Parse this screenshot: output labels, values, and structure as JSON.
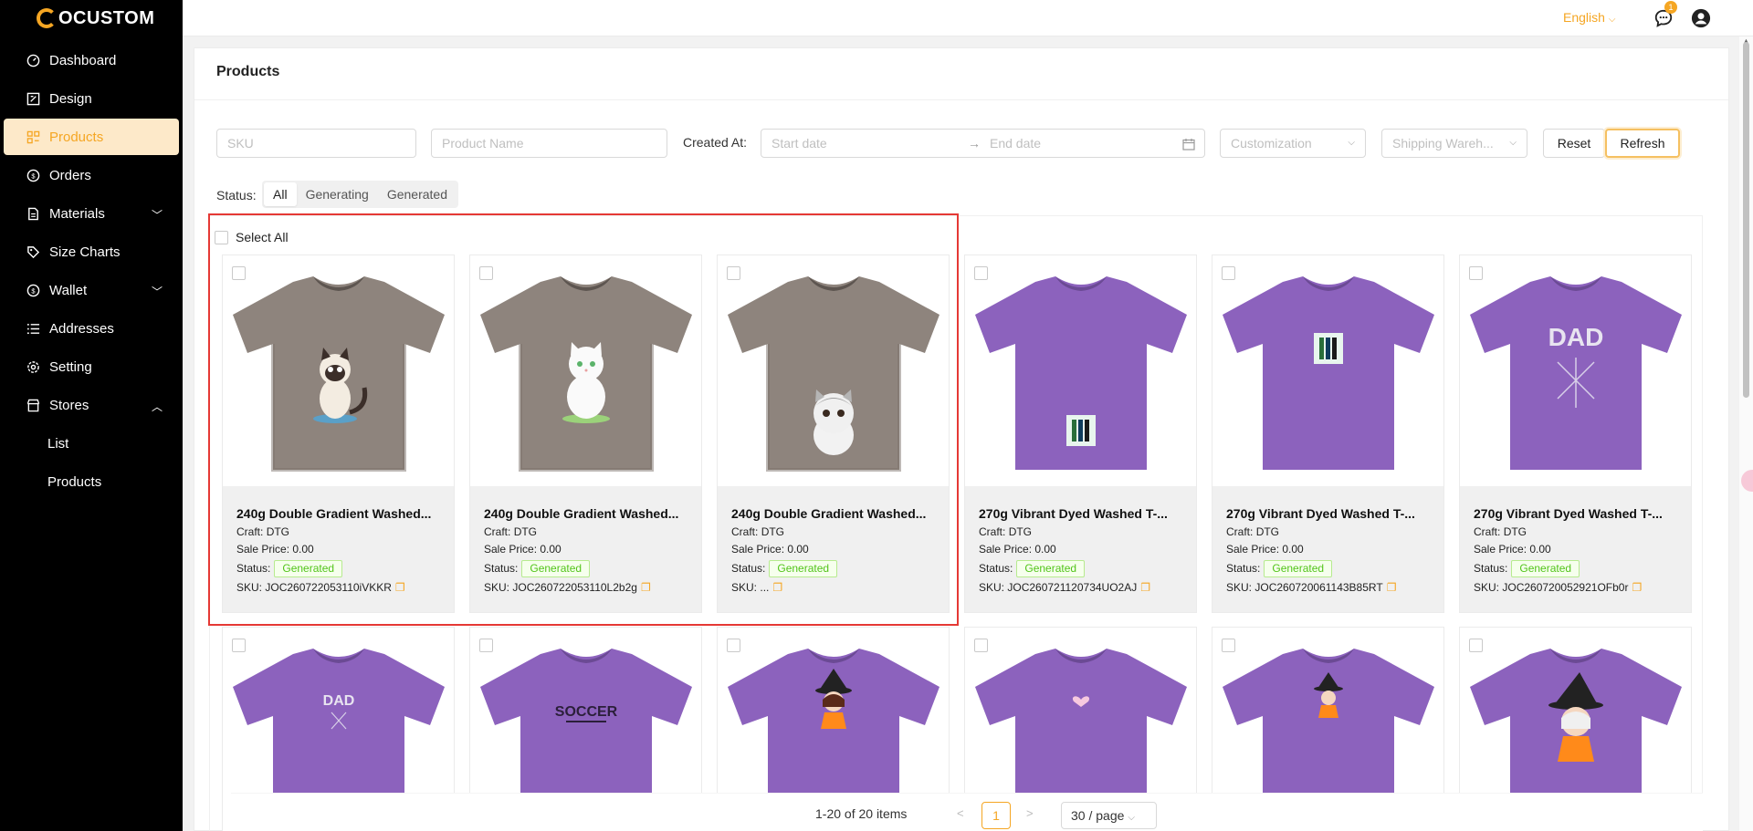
{
  "brand": {
    "name": "OCUSTOM"
  },
  "sidebar": {
    "items": [
      {
        "label": "Dashboard",
        "icon": "dashboard-icon"
      },
      {
        "label": "Design",
        "icon": "design-icon"
      },
      {
        "label": "Products",
        "icon": "products-icon",
        "active": true
      },
      {
        "label": "Orders",
        "icon": "orders-icon"
      },
      {
        "label": "Materials",
        "icon": "materials-icon",
        "expand": "down"
      },
      {
        "label": "Size Charts",
        "icon": "tag-icon"
      },
      {
        "label": "Wallet",
        "icon": "wallet-icon",
        "expand": "down"
      },
      {
        "label": "Addresses",
        "icon": "list-icon"
      },
      {
        "label": "Setting",
        "icon": "gear-icon"
      },
      {
        "label": "Stores",
        "icon": "store-icon",
        "expand": "up"
      }
    ],
    "sub_items": [
      {
        "label": "List"
      },
      {
        "label": "Products"
      }
    ]
  },
  "header": {
    "language": "English",
    "notification_count": "1"
  },
  "page": {
    "title": "Products"
  },
  "filters": {
    "sku_placeholder": "SKU",
    "name_placeholder": "Product Name",
    "created_at_label": "Created At:",
    "start_date_placeholder": "Start date",
    "end_date_placeholder": "End date",
    "customization_placeholder": "Customization",
    "warehouse_placeholder": "Shipping Wareh...",
    "reset_label": "Reset",
    "refresh_label": "Refresh"
  },
  "status_filter": {
    "label": "Status:",
    "options": [
      "All",
      "Generating",
      "Generated"
    ],
    "selected": "All"
  },
  "select_all_label": "Select All",
  "card_labels": {
    "craft": "Craft:",
    "sale_price": "Sale Price:",
    "status": "Status:",
    "sku": "SKU:"
  },
  "products": [
    {
      "name": "240g Double Gradient Washed...",
      "craft": "DTG",
      "price": "0.00",
      "status": "Generated",
      "sku": "JOC260722053110iVKKR",
      "shirt": "washed",
      "print": "siamese-cat"
    },
    {
      "name": "240g Double Gradient Washed...",
      "craft": "DTG",
      "price": "0.00",
      "status": "Generated",
      "sku": "JOC260722053110L2b2g",
      "shirt": "washed",
      "print": "white-cat"
    },
    {
      "name": "240g Double Gradient Washed...",
      "craft": "DTG",
      "price": "0.00",
      "status": "Generated",
      "sku": "...",
      "shirt": "washed",
      "print": "grey-cat"
    },
    {
      "name": "270g Vibrant Dyed Washed T-...",
      "craft": "DTG",
      "price": "0.00",
      "status": "Generated",
      "sku": "JOC260721120734UO2AJ",
      "shirt": "purple",
      "print": "square-low"
    },
    {
      "name": "270g Vibrant Dyed Washed T-...",
      "craft": "DTG",
      "price": "0.00",
      "status": "Generated",
      "sku": "JOC260720061143B85RT",
      "shirt": "purple",
      "print": "square-high"
    },
    {
      "name": "270g Vibrant Dyed Washed T-...",
      "craft": "DTG",
      "price": "0.00",
      "status": "Generated",
      "sku": "JOC260720052921OFb0r",
      "shirt": "purple",
      "print": "dad-big"
    },
    {
      "name": "",
      "shirt": "purple",
      "print": "dad-small"
    },
    {
      "name": "",
      "shirt": "purple",
      "print": "soccer"
    },
    {
      "name": "",
      "shirt": "purple",
      "print": "witch"
    },
    {
      "name": "",
      "shirt": "purple",
      "print": "heart"
    },
    {
      "name": "",
      "shirt": "purple",
      "print": "witch-small"
    },
    {
      "name": "",
      "shirt": "purple",
      "print": "witch-big"
    }
  ],
  "print_text": {
    "dad": "DAD",
    "soccer": "SOCCER"
  },
  "pagination": {
    "total_text": "1-20 of 20 items",
    "current_page": "1",
    "page_size": "30 / page"
  },
  "colors": {
    "accent": "#f5a623",
    "washed_shirt": "#8e847d",
    "purple_shirt": "#8c62bd",
    "status_green": "#52c41a",
    "highlight_box": "#e53935"
  }
}
